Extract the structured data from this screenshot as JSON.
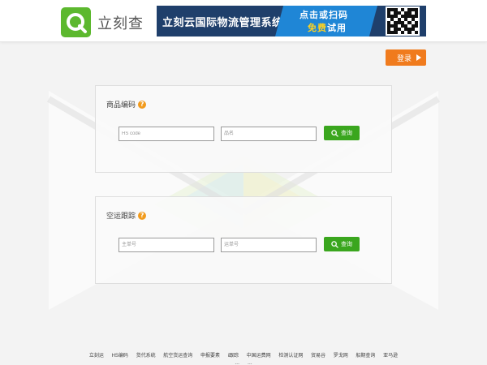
{
  "header": {
    "logo_text": "立刻查",
    "banner": {
      "title": "立刻云国际物流管理系统",
      "cta_line1": "点击或扫码",
      "cta_line2_highlight": "免费",
      "cta_line2_rest": "试用"
    }
  },
  "login_label": "登录",
  "panels": [
    {
      "title": "商品编码",
      "inputs": [
        {
          "placeholder": "HS code",
          "value": ""
        },
        {
          "placeholder": "品名",
          "value": ""
        }
      ],
      "button_label": "查询"
    },
    {
      "title": "空运跟踪",
      "inputs": [
        {
          "placeholder": "主单号",
          "value": ""
        },
        {
          "placeholder": "运单号",
          "value": ""
        }
      ],
      "button_label": "查询"
    }
  ],
  "footer": {
    "links": [
      "立刻运",
      "HS编码",
      "货代系统",
      "航空货运查询",
      "申报要素",
      "i跟踪",
      "中国运费网",
      "检测认证网",
      "贸易谷",
      "罗戈网",
      "船期查询",
      "亚马逊"
    ],
    "links_line2": [
      "…",
      "…"
    ]
  },
  "colors": {
    "brand_green": "#5cb82e",
    "login_orange": "#f07b1d",
    "query_green": "#3aa61e",
    "banner_navy": "#1f3f6b",
    "banner_blue": "#1f86d6",
    "help_orange": "#f29b1d"
  },
  "icons": {
    "logo": "magnifier-q-icon",
    "help": "question-icon",
    "query": "search-icon",
    "login_arrow": "play-arrow-icon"
  }
}
